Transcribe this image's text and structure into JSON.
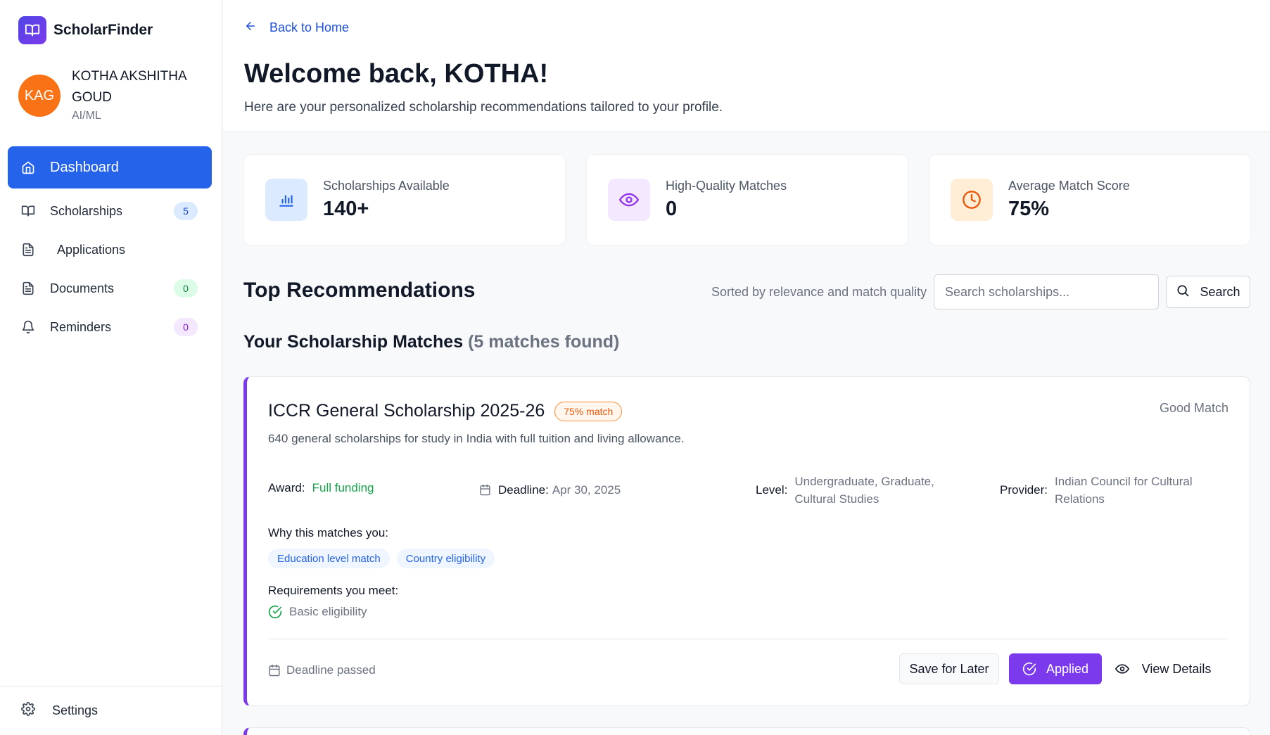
{
  "app": {
    "name": "ScholarFinder"
  },
  "user": {
    "initials": "KAG",
    "name": "KOTHA AKSHITHA GOUD",
    "department": "AI/ML"
  },
  "sidebar": {
    "items": [
      {
        "label": "Dashboard",
        "badge": ""
      },
      {
        "label": "Scholarships",
        "badge": "5"
      },
      {
        "label": "Applications",
        "badge": ""
      },
      {
        "label": "Documents",
        "badge": "0"
      },
      {
        "label": "Reminders",
        "badge": "0"
      }
    ],
    "settings_label": "Settings"
  },
  "header": {
    "back_label": "Back to Home",
    "title": "Welcome back, KOTHA!",
    "subtitle": "Here are your personalized scholarship recommendations tailored to your profile."
  },
  "stats": [
    {
      "label": "Scholarships Available",
      "value": "140+",
      "icon": "bar-chart-icon",
      "color": "#2563eb"
    },
    {
      "label": "High-Quality Matches",
      "value": "0",
      "icon": "eye-icon",
      "color": "#9333ea"
    },
    {
      "label": "Average Match Score",
      "value": "75%",
      "icon": "clock-icon",
      "color": "#ea580c"
    }
  ],
  "recommendations": {
    "title": "Top Recommendations",
    "sorted_text": "Sorted by relevance and match quality",
    "search_placeholder": "Search scholarships...",
    "search_label": "Search",
    "matches_title": "Your Scholarship Matches",
    "matches_count": "(5 matches found)"
  },
  "scholarship": {
    "title": "ICCR General Scholarship 2025-26",
    "match": "75% match",
    "quality": "Good Match",
    "description": "640 general scholarships for study in India with full tuition and living allowance.",
    "award_label": "Award:",
    "award": "Full funding",
    "deadline_label": "Deadline:",
    "deadline": "Apr 30, 2025",
    "level_label": "Level:",
    "level": "Undergraduate, Graduate, Cultural Studies",
    "provider_label": "Provider:",
    "provider": "Indian Council for Cultural Relations",
    "why_title": "Why this matches you:",
    "tags": [
      "Education level match",
      "Country eligibility"
    ],
    "requirements_title": "Requirements you meet:",
    "requirements": [
      "Basic eligibility"
    ],
    "deadline_status": "Deadline passed",
    "save_label": "Save for Later",
    "applied_label": "Applied",
    "view_label": "View Details",
    "accent_color": "#7c3aed"
  }
}
